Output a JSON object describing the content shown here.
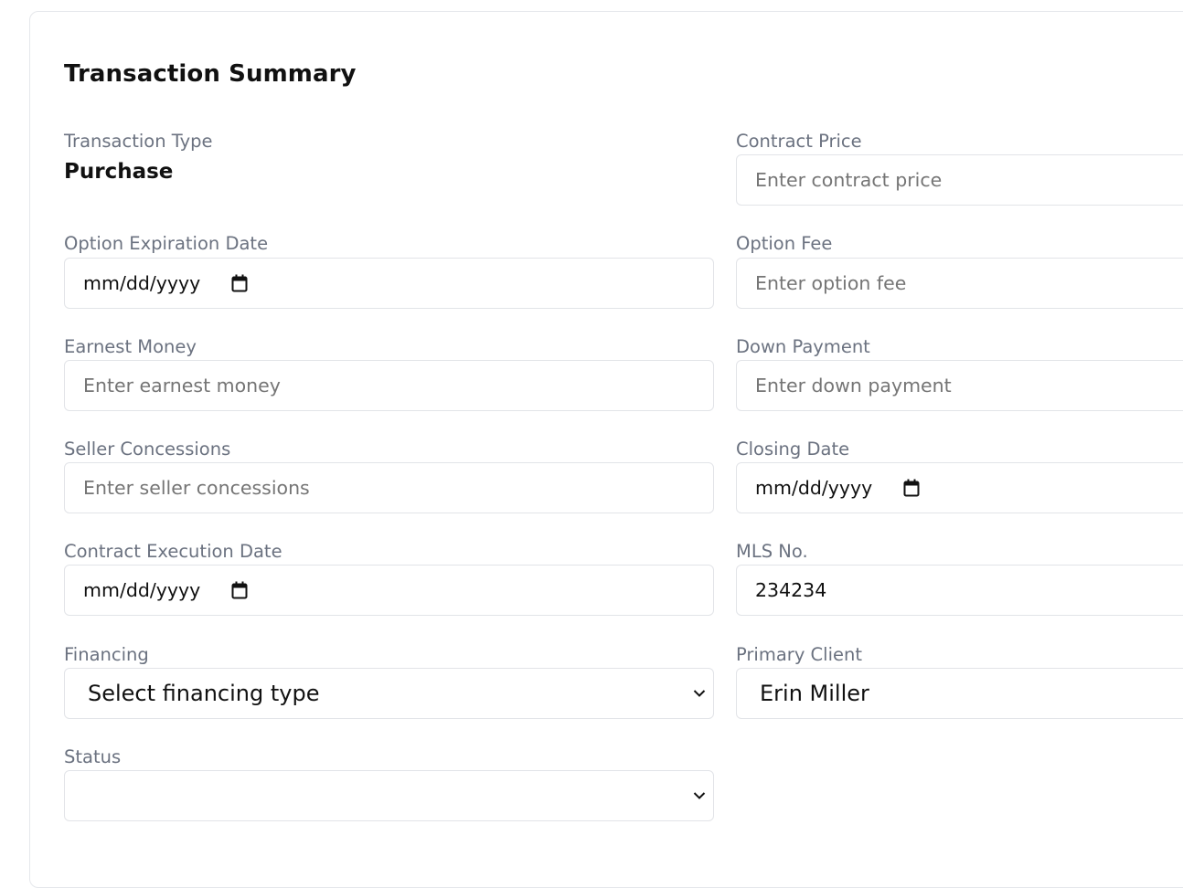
{
  "section": {
    "title": "Transaction Summary"
  },
  "fields": {
    "transaction_type": {
      "label": "Transaction Type",
      "value": "Purchase"
    },
    "contract_price": {
      "label": "Contract Price",
      "placeholder": "Enter contract price"
    },
    "option_expiration_date": {
      "label": "Option Expiration Date",
      "placeholder": "mm/dd/yyyy"
    },
    "option_fee": {
      "label": "Option Fee",
      "placeholder": "Enter option fee"
    },
    "earnest_money": {
      "label": "Earnest Money",
      "placeholder": "Enter earnest money"
    },
    "down_payment": {
      "label": "Down Payment",
      "placeholder": "Enter down payment"
    },
    "seller_concessions": {
      "label": "Seller Concessions",
      "placeholder": "Enter seller concessions"
    },
    "closing_date": {
      "label": "Closing Date",
      "placeholder": "mm/dd/yyyy"
    },
    "contract_execution_date": {
      "label": "Contract Execution Date",
      "placeholder": "mm/dd/yyyy"
    },
    "mls_no": {
      "label": "MLS No.",
      "value": "234234"
    },
    "financing": {
      "label": "Financing",
      "selected": "Select financing type"
    },
    "primary_client": {
      "label": "Primary Client",
      "value": "Erin Miller"
    },
    "status": {
      "label": "Status",
      "selected": ""
    }
  },
  "icons": {
    "date_picker": "calendar-icon",
    "select": "chevron-down-icon"
  }
}
